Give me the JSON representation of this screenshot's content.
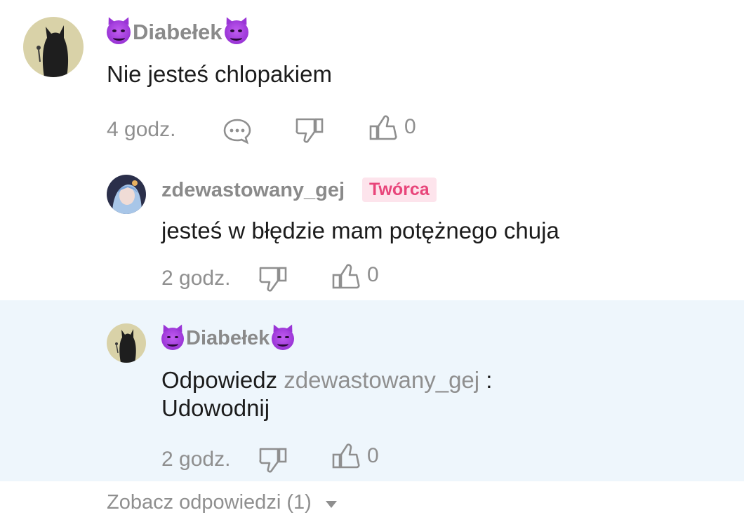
{
  "comments": [
    {
      "username": "Diabełek",
      "text": "Nie jesteś chlopakiem",
      "time": "4 godz.",
      "like_count": "0"
    },
    {
      "username": "zdewastowany_gej",
      "badge": "Twórca",
      "text": "jesteś w błędzie mam potężnego chuja",
      "time": "2 godz.",
      "like_count": "0"
    },
    {
      "username": "Diabełek",
      "reply_prefix": "Odpowiedz",
      "reply_to": "zdewastowany_gej",
      "reply_sep": " :",
      "text": "Udowodnij",
      "time": "2 godz.",
      "like_count": "0"
    }
  ],
  "view_replies": "Zobacz odpowiedzi (1)",
  "colors": {
    "badge_bg": "#fde4ec",
    "badge_text": "#e8457a",
    "highlight_bg": "#eef6fc"
  }
}
